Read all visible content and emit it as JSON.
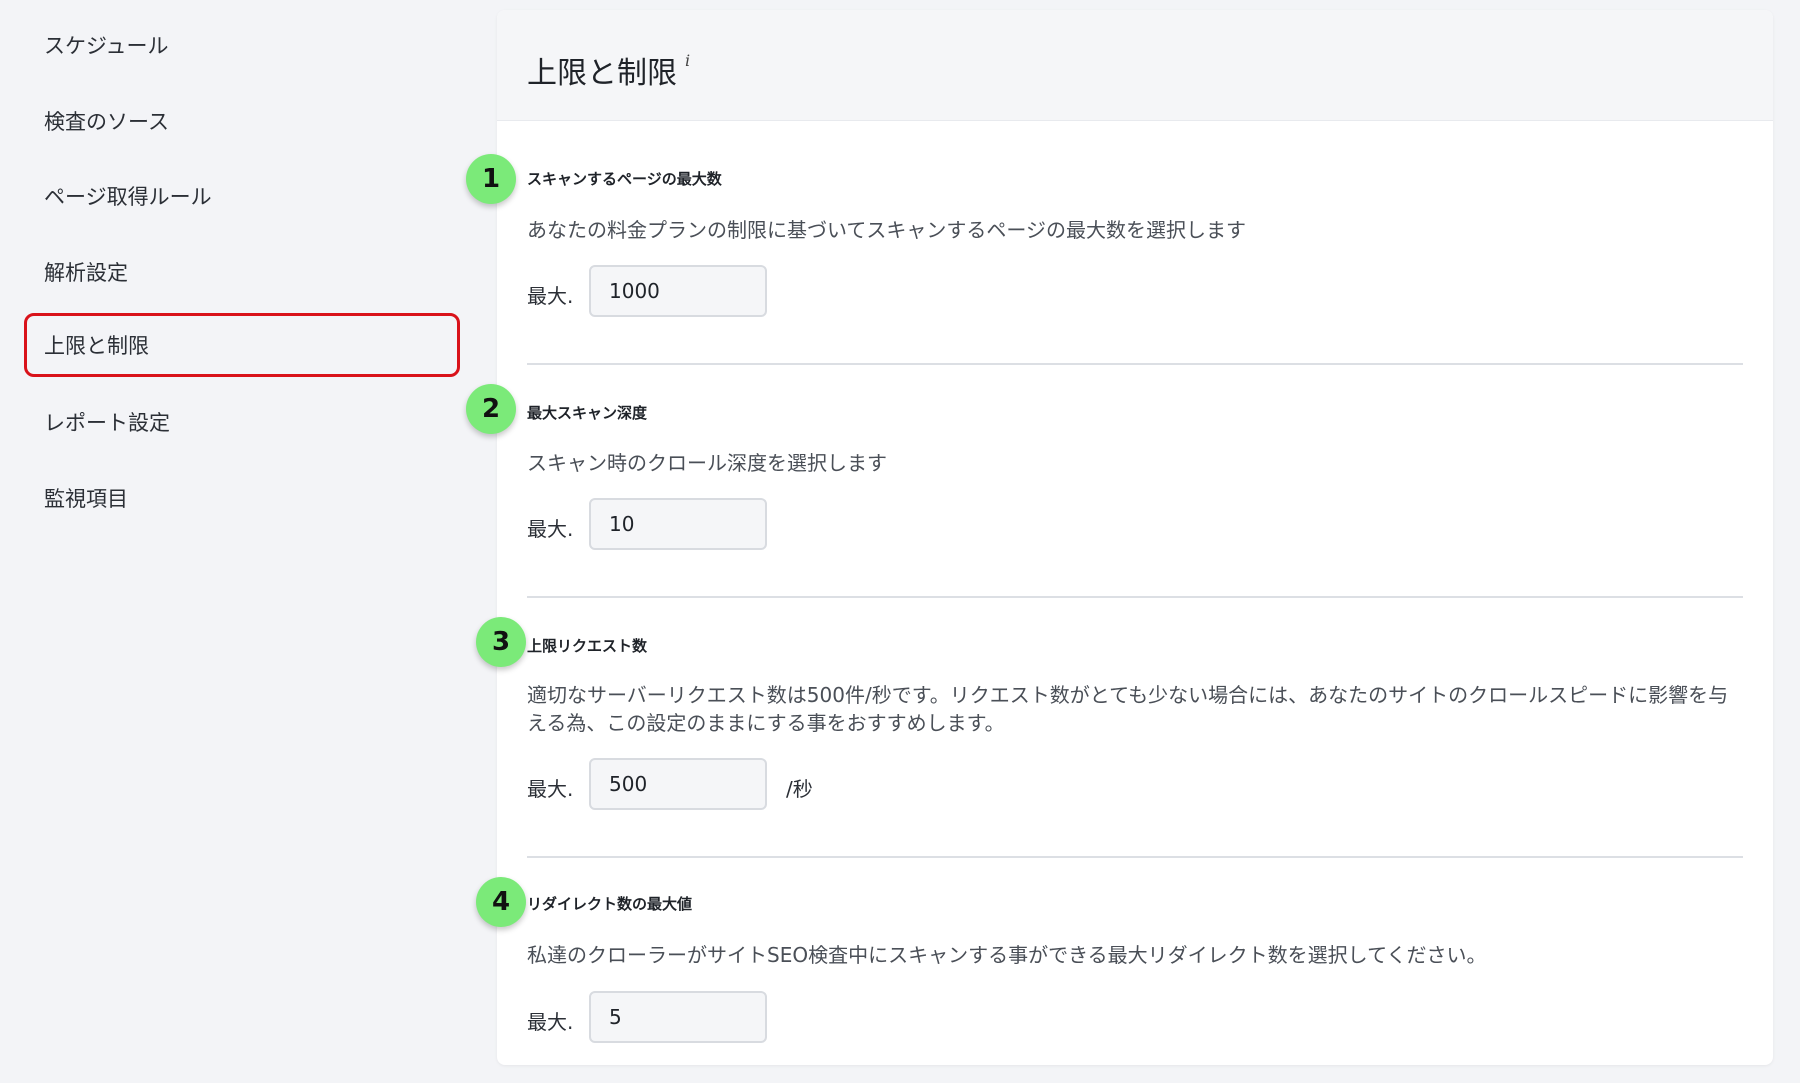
{
  "sidebar": {
    "items": [
      {
        "label": "スケジュール"
      },
      {
        "label": "検査のソース"
      },
      {
        "label": "ページ取得ルール"
      },
      {
        "label": "解析設定"
      },
      {
        "label": "上限と制限",
        "active": true
      },
      {
        "label": "レポート設定"
      },
      {
        "label": "監視項目"
      }
    ],
    "active_border_color": "#d9121a"
  },
  "panel": {
    "title": "上限と制限",
    "info_icon": "i"
  },
  "sections": [
    {
      "badge": "1",
      "title": "スキャンするページの最大数",
      "description": "あなたの料金プランの制限に基づいてスキャンするページの最大数を選択します",
      "max_label": "最大.",
      "value": "1000"
    },
    {
      "badge": "2",
      "title": "最大スキャン深度",
      "description": "スキャン時のクロール深度を選択します",
      "max_label": "最大.",
      "value": "10"
    },
    {
      "badge": "3",
      "title": "上限リクエスト数",
      "description": "適切なサーバーリクエスト数は500件/秒です。リクエスト数がとても少ない場合には、あなたのサイトのクロールスピードに影響を与える為、この設定のままにする事をおすすめします。",
      "max_label": "最大.",
      "value": "500",
      "unit": "/秒"
    },
    {
      "badge": "4",
      "title": "リダイレクト数の最大値",
      "description": "私達のクローラーがサイトSEO検査中にスキャンする事ができる最大リダイレクト数を選択してください。",
      "max_label": "最大.",
      "value": "5"
    }
  ],
  "colors": {
    "badge": "#7bea79",
    "background": "#f3f4f7",
    "panel": "#ffffff"
  }
}
